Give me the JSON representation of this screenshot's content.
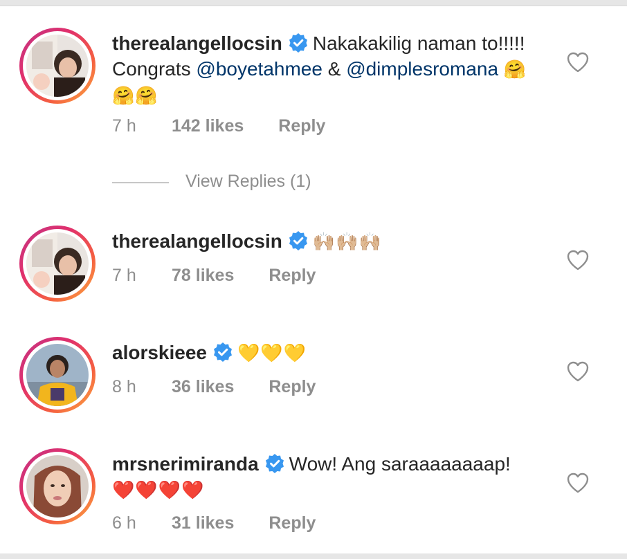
{
  "comments": [
    {
      "username": "therealangellocsin",
      "verified": true,
      "text_before": "Nakakakilig naman to!!!!! Congrats ",
      "mention1": "@boyetahmee",
      "text_mid": " & ",
      "mention2": "@dimplesromana",
      "emoji": "🤗🤗🤗",
      "time": "7 h",
      "likes": "142 likes",
      "reply": "Reply",
      "view_replies": "View Replies (1)"
    },
    {
      "username": "therealangellocsin",
      "verified": true,
      "emoji": "🙌🏼🙌🏼🙌🏼",
      "time": "7 h",
      "likes": "78 likes",
      "reply": "Reply"
    },
    {
      "username": "alorskieee",
      "verified": true,
      "emoji": "💛💛💛",
      "time": "8 h",
      "likes": "36 likes",
      "reply": "Reply"
    },
    {
      "username": "mrsnerimiranda",
      "verified": true,
      "text": "Wow! Ang saraaaaaaaap!",
      "emoji": "❤️❤️❤️❤️",
      "time": "6 h",
      "likes": "31 likes",
      "reply": "Reply"
    }
  ],
  "colors": {
    "verified_badge": "#3897f0",
    "mention": "#003569",
    "meta": "#8e8e8e",
    "ring_start": "#c13584",
    "ring_end": "#fcaf45"
  },
  "icons": {
    "verified": "verified-badge-icon",
    "like": "heart-outline-icon"
  }
}
